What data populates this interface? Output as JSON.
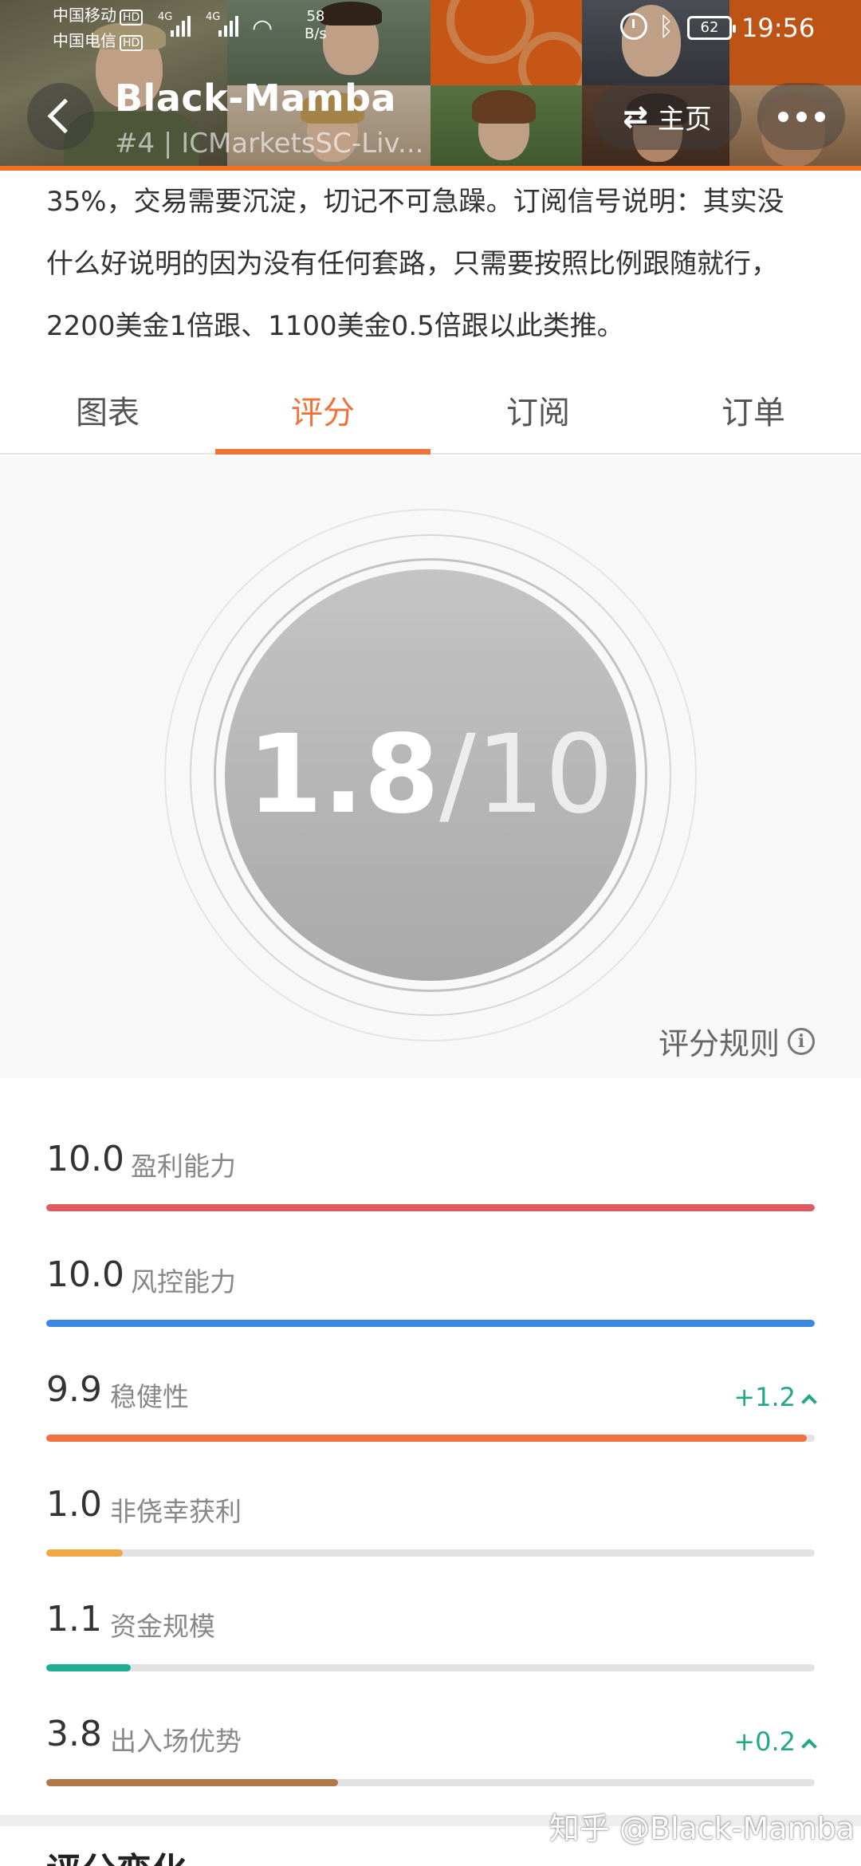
{
  "status_bar": {
    "carrier1": "中国移动",
    "carrier2": "中国电信",
    "hd": "HD",
    "network_gen": "4G",
    "net_speed_value": "58",
    "net_speed_unit": "B/s",
    "battery": "62",
    "time": "19:56"
  },
  "header": {
    "title": "Black-Mamba",
    "subtitle": "#4 | ICMarketsSC-Liv...",
    "home_label": "主页",
    "back_icon": "back-arrow-icon",
    "more_icon": "more-dots-icon"
  },
  "description": {
    "lines": [
      "35%，交易需要沉淀，切记不可急躁。订阅信号说明：其实没",
      "什么好说明的因为没有任何套路，只需要按照比例跟随就行，",
      "2200美金1倍跟、1100美金0.5倍跟以此类推。"
    ]
  },
  "tabs": [
    {
      "label": "图表",
      "active": false
    },
    {
      "label": "评分",
      "active": true
    },
    {
      "label": "订阅",
      "active": false
    },
    {
      "label": "订单",
      "active": false
    }
  ],
  "score": {
    "value": "1.8",
    "separator": "/",
    "max": "10",
    "rules_label": "评分规则"
  },
  "metrics": [
    {
      "value": "10.0",
      "label": "盈利能力",
      "fraction": 1.0,
      "color": "#e05a62",
      "delta": ""
    },
    {
      "value": "10.0",
      "label": "风控能力",
      "fraction": 1.0,
      "color": "#3b86e0",
      "delta": ""
    },
    {
      "value": "9.9",
      "label": "稳健性",
      "fraction": 0.99,
      "color": "#f07040",
      "delta": "+1.2"
    },
    {
      "value": "1.0",
      "label": "非侥幸获利",
      "fraction": 0.1,
      "color": "#f0a845",
      "delta": ""
    },
    {
      "value": "1.1",
      "label": "资金规模",
      "fraction": 0.11,
      "color": "#1fae92",
      "delta": ""
    },
    {
      "value": "3.8",
      "label": "出入场优势",
      "fraction": 0.38,
      "color": "#b07a48",
      "delta": "+0.2"
    }
  ],
  "next_section": {
    "heading": "评分变化"
  },
  "watermark": "知乎 @Black-Mamba"
}
